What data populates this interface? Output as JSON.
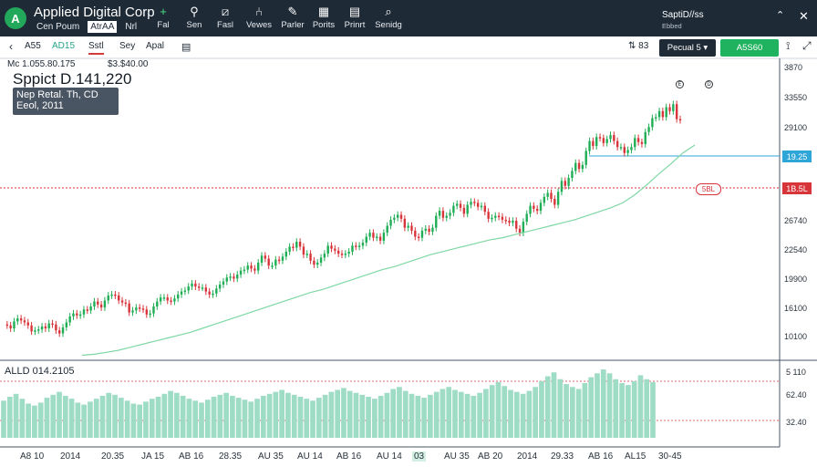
{
  "app": {
    "title": "Applied Digital Corp"
  },
  "menu": [
    {
      "label": "Cen Poum",
      "active": false
    },
    {
      "label": "AtrAA",
      "active": true
    },
    {
      "label": "Nrl",
      "active": false
    }
  ],
  "tools": [
    {
      "icon": "plus-icon",
      "glyph": "+",
      "label": "Fal"
    },
    {
      "icon": "search-icon",
      "glyph": "⚲",
      "label": "Sen"
    },
    {
      "icon": "draw-icon",
      "glyph": "⧄",
      "label": "Fasl"
    },
    {
      "icon": "indicators-icon",
      "glyph": "⑃",
      "label": "Vewes"
    },
    {
      "icon": "pencil-icon",
      "glyph": "✎",
      "label": "Parler"
    },
    {
      "icon": "chart-icon",
      "glyph": "▦",
      "label": "Porits"
    },
    {
      "icon": "print-icon",
      "glyph": "▤",
      "label": "Prinrt"
    },
    {
      "icon": "search-icon",
      "glyph": "⌕",
      "label": "Senidg"
    }
  ],
  "account": {
    "name": "SaptiD//ss",
    "sub": "Ebbed"
  },
  "toolbar": {
    "symbol": "A55",
    "timeframe": "AD15",
    "tabs": [
      "Sstl",
      "Sey",
      "Apal"
    ],
    "mini_label": "83",
    "period_button": "Pecual 5 ▾",
    "action_button": "A5S60"
  },
  "legend": {
    "ohlc": "Mc 1.055.80.175",
    "price_small": "$3.$40.00",
    "big_price": "Sppict D.141,220",
    "info_line1": "Nep Retal. Th, CD",
    "info_line2": "Eeol, 2011"
  },
  "price_axis": [
    "3870",
    "33550",
    "29100",
    "26740",
    "22540",
    "19900",
    "16100",
    "10100"
  ],
  "price_tags": {
    "blue": "19.25",
    "red": "1B.5L"
  },
  "bubble_label": "5BL",
  "volume_panel": {
    "label": "ALLD 014.2105",
    "axis": [
      "5 110",
      "62.40",
      "32.40"
    ]
  },
  "date_axis": [
    "A8 10",
    "2014",
    "20.35",
    "JA 15",
    "AB 16",
    "28.35",
    "AU 35",
    "AU 14",
    "AB 16",
    "AU 14",
    "03",
    "AU 35",
    "AB 20",
    "2014",
    "29.33",
    "AB 16",
    "AL15",
    "30-45"
  ],
  "date_highlight_index": 10,
  "colors": {
    "up": "#1fae55",
    "down": "#d8353b",
    "ma": "#7ed7a4",
    "volume": "#9fdcc6",
    "header_bg": "#1f2a37"
  },
  "chart_data": {
    "type": "candlestick",
    "title": "Sppict D.141,220",
    "series": [
      {
        "name": "price",
        "values": [
          3.6,
          3.5,
          3.2,
          3.9,
          4.2,
          4.0,
          3.8,
          3.5,
          2.9,
          3.0,
          3.1,
          3.4,
          3.2,
          3.7,
          3.6,
          3.0,
          2.7,
          3.3,
          3.8,
          4.4,
          4.7,
          4.5,
          4.6,
          5.1,
          5.0,
          5.4,
          5.9,
          5.6,
          5.3,
          6.0,
          6.5,
          6.6,
          6.5,
          6.0,
          5.8,
          5.7,
          4.8,
          5.0,
          5.3,
          5.2,
          5.1,
          4.6,
          4.7,
          5.4,
          5.9,
          6.3,
          6.3,
          6.0,
          5.9,
          6.2,
          6.6,
          6.9,
          7.0,
          7.4,
          7.7,
          7.4,
          7.3,
          7.3,
          6.9,
          6.6,
          6.7,
          7.2,
          7.6,
          7.9,
          8.3,
          8.4,
          8.2,
          8.6,
          9.0,
          9.1,
          9.5,
          9.2,
          9.0,
          9.8,
          10.5,
          10.2,
          9.5,
          9.5,
          10.1,
          10.0,
          10.4,
          10.9,
          11.4,
          11.3,
          11.9,
          11.4,
          10.6,
          10.7,
          10.0,
          9.6,
          9.8,
          10.3,
          10.7,
          11.5,
          11.2,
          11.0,
          10.7,
          10.6,
          10.7,
          10.9,
          11.5,
          11.4,
          11.5,
          11.8,
          12.4,
          12.8,
          12.3,
          12.4,
          12.0,
          12.8,
          13.5,
          14.1,
          14.3,
          14.6,
          14.2,
          13.3,
          13.5,
          13.0,
          12.4,
          12.3,
          13.0,
          13.2,
          12.9,
          13.3,
          14.5,
          15.0,
          14.3,
          14.5,
          14.8,
          15.5,
          15.7,
          15.3,
          14.7,
          15.6,
          15.9,
          15.8,
          15.4,
          15.5,
          14.9,
          14.2,
          14.3,
          14.5,
          14.4,
          14.1,
          14.0,
          13.8,
          14.0,
          13.2,
          12.8,
          13.9,
          14.7,
          15.5,
          15.2,
          15.0,
          15.8,
          16.4,
          16.8,
          16.2,
          15.6,
          16.9,
          18.0,
          17.5,
          18.3,
          19.0,
          19.8,
          19.2,
          19.6,
          21.0,
          22.0,
          21.5,
          22.4,
          22.3,
          21.8,
          22.2,
          22.6,
          22.0,
          21.4,
          21.4,
          20.8,
          21.1,
          21.4,
          22.3,
          21.9,
          21.7,
          22.9,
          23.4,
          24.3,
          24.4,
          25.0,
          24.4,
          25.4,
          25.0,
          25.7,
          24.2,
          24.1
        ]
      },
      {
        "name": "moving average",
        "values": [
          0.5,
          0.6,
          0.8,
          1.0,
          1.3,
          1.6,
          1.9,
          2.2,
          2.5,
          2.8,
          3.2,
          3.6,
          4.0,
          4.4,
          4.8,
          5.2,
          5.6,
          6.0,
          6.4,
          6.8,
          7.1,
          7.5,
          7.9,
          8.3,
          8.7,
          9.1,
          9.4,
          9.8,
          10.2,
          10.6,
          10.9,
          11.2,
          11.5,
          11.8,
          12.1,
          12.3,
          12.6,
          12.9,
          13.2,
          13.5,
          13.8,
          14.1,
          14.5,
          14.9,
          15.3,
          15.8,
          16.6,
          17.6,
          18.7,
          19.7,
          20.8,
          21.6
        ]
      }
    ],
    "volume": [
      38,
      42,
      45,
      40,
      35,
      33,
      36,
      41,
      44,
      47,
      43,
      40,
      36,
      34,
      37,
      40,
      43,
      46,
      44,
      41,
      38,
      35,
      34,
      37,
      40,
      42,
      45,
      48,
      46,
      43,
      40,
      38,
      36,
      39,
      42,
      44,
      46,
      43,
      41,
      39,
      37,
      40,
      43,
      45,
      47,
      49,
      46,
      44,
      42,
      40,
      38,
      41,
      44,
      47,
      49,
      51,
      48,
      46,
      44,
      42,
      40,
      43,
      46,
      50,
      52,
      48,
      45,
      43,
      41,
      44,
      47,
      50,
      52,
      49,
      47,
      45,
      43,
      46,
      50,
      54,
      57,
      53,
      49,
      47,
      45,
      48,
      52,
      58,
      63,
      67,
      60,
      55,
      52,
      50,
      56,
      62,
      66,
      70,
      66,
      60,
      56,
      54,
      58,
      64,
      60,
      57
    ],
    "ylim": [
      0,
      27
    ],
    "price_axis_labels": [
      "3870",
      "33550",
      "29100",
      "26740",
      "22540",
      "19900",
      "16100",
      "10100"
    ],
    "volume_axis_labels": [
      "5 110",
      "62.40",
      "32.40"
    ],
    "x_labels": [
      "A8 10",
      "2014",
      "20.35",
      "JA 15",
      "AB 16",
      "28.35",
      "AU 35",
      "AU 14",
      "AB 16",
      "AU 14",
      "03",
      "AU 35",
      "AB 20",
      "2014",
      "29.33",
      "AB 16",
      "AL15",
      "30-45"
    ],
    "horizontal_lines": [
      {
        "label": "19.25",
        "color": "blue"
      },
      {
        "label": "1B.5L",
        "color": "red"
      }
    ],
    "grid": false,
    "legend": "none"
  }
}
